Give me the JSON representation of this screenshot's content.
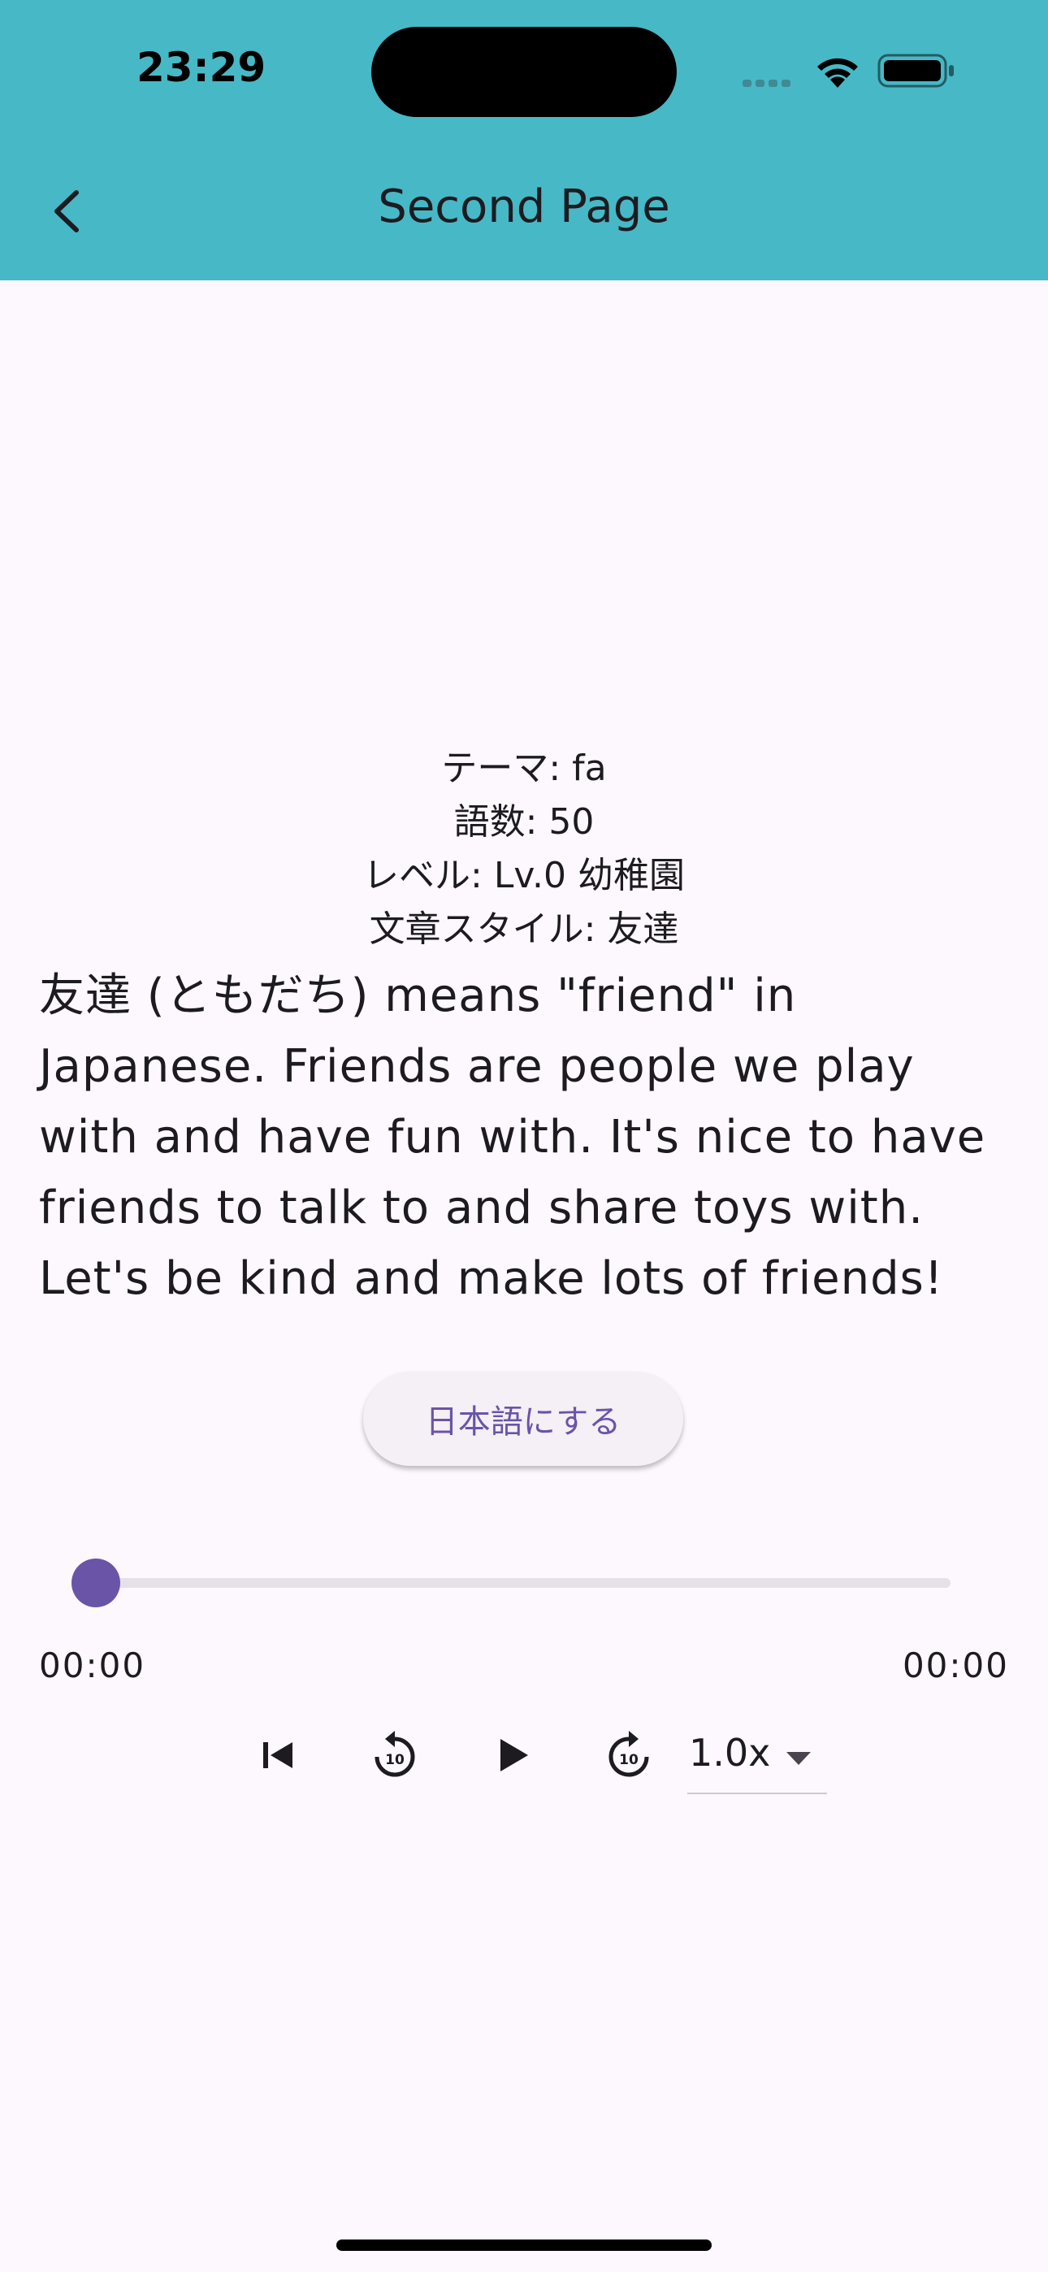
{
  "status_bar": {
    "time": "23:29"
  },
  "app_bar": {
    "title": "Second Page"
  },
  "meta": {
    "theme": "テーマ: fa",
    "word_count": "語数: 50",
    "level": "レベル: Lv.0 幼稚園",
    "style": "文章スタイル: 友達"
  },
  "story": {
    "lines": [
      "友達 (ともだち) means \"friend\" in",
      "Japanese. Friends are people we play",
      "with and have fun with. It's nice to have",
      "friends to talk to and share toys with.",
      "Let's be kind and make lots of friends!"
    ]
  },
  "translate_button": {
    "label": "日本語にする"
  },
  "player": {
    "position": "00:00",
    "duration": "00:00",
    "progress_fraction": 0,
    "speed": "1.0x"
  },
  "colors": {
    "app_bar": "#47b8c6",
    "accent": "#6a54a8",
    "background": "#fdf8fd"
  },
  "icons": [
    "back-arrow-icon",
    "skip-previous-icon",
    "replay-10-icon",
    "play-icon",
    "forward-10-icon",
    "dropdown-caret-icon",
    "wifi-icon",
    "battery-icon"
  ]
}
